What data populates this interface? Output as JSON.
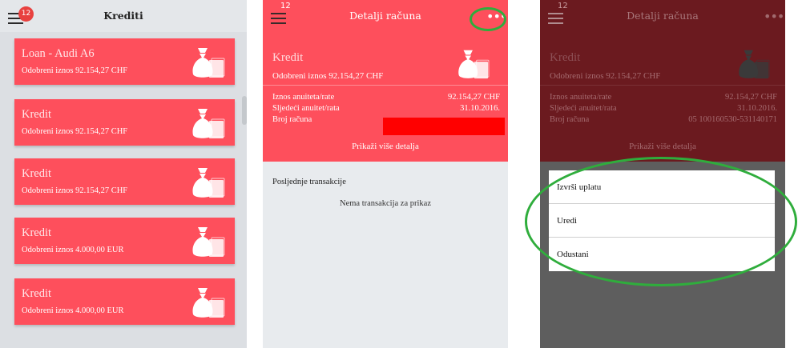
{
  "colors": {
    "accent": "#fe4f5c",
    "dark_overlay": "#6b1a1f",
    "highlight": "#2fad3c",
    "badge": "#e8413f"
  },
  "panel1": {
    "header": {
      "title": "Krediti",
      "badge_count": "12",
      "menu_icon": "hamburger-icon"
    },
    "loans": [
      {
        "name": "Loan - Audi A6",
        "amount": "Odobreni iznos 92.154,27 CHF",
        "icon": "money-bag-icon"
      },
      {
        "name": "Kredit",
        "amount": "Odobreni iznos 92.154,27 CHF",
        "icon": "money-bag-icon"
      },
      {
        "name": "Kredit",
        "amount": "Odobreni iznos 92.154,27 CHF",
        "icon": "money-bag-icon"
      },
      {
        "name": "Kredit",
        "amount": "Odobreni iznos 4.000,00 EUR",
        "icon": "money-bag-icon"
      },
      {
        "name": "Kredit",
        "amount": "Odobreni iznos 4.000,00 EUR",
        "icon": "money-bag-icon"
      }
    ]
  },
  "panel2": {
    "header": {
      "title": "Detalji računa",
      "badge_count": "12",
      "more_icon": "more-dots-icon",
      "more_glyph": "•••"
    },
    "account": {
      "name": "Kredit",
      "amount": "Odobreni iznos 92.154,27 CHF",
      "rows": [
        {
          "label": "Iznos anuiteta/rate",
          "value": "92.154,27 CHF"
        },
        {
          "label": "Sljedeći anuitet/rata",
          "value": "31.10.2016."
        },
        {
          "label": "Broj računa",
          "value": ""
        }
      ],
      "more_link": "Prikaži više detalja"
    },
    "transactions": {
      "heading": "Posljednje transakcije",
      "empty": "Nema transakcija za prikaz"
    }
  },
  "panel3": {
    "header": {
      "title": "Detalji računa",
      "badge_count": "12",
      "more_glyph": "•••"
    },
    "account": {
      "name": "Kredit",
      "amount": "Odobreni iznos 92.154,27 CHF",
      "rows": [
        {
          "label": "Iznos anuiteta/rate",
          "value": "92.154,27 CHF"
        },
        {
          "label": "Sljedeći anuitet/rata",
          "value": "31.10.2016."
        },
        {
          "label": "Broj računa",
          "value": "05 100160530-531140171"
        }
      ],
      "more_link": "Prikaži više detalja"
    },
    "action_sheet": [
      "Izvrši uplatu",
      "Uredi",
      "Odustani"
    ]
  }
}
